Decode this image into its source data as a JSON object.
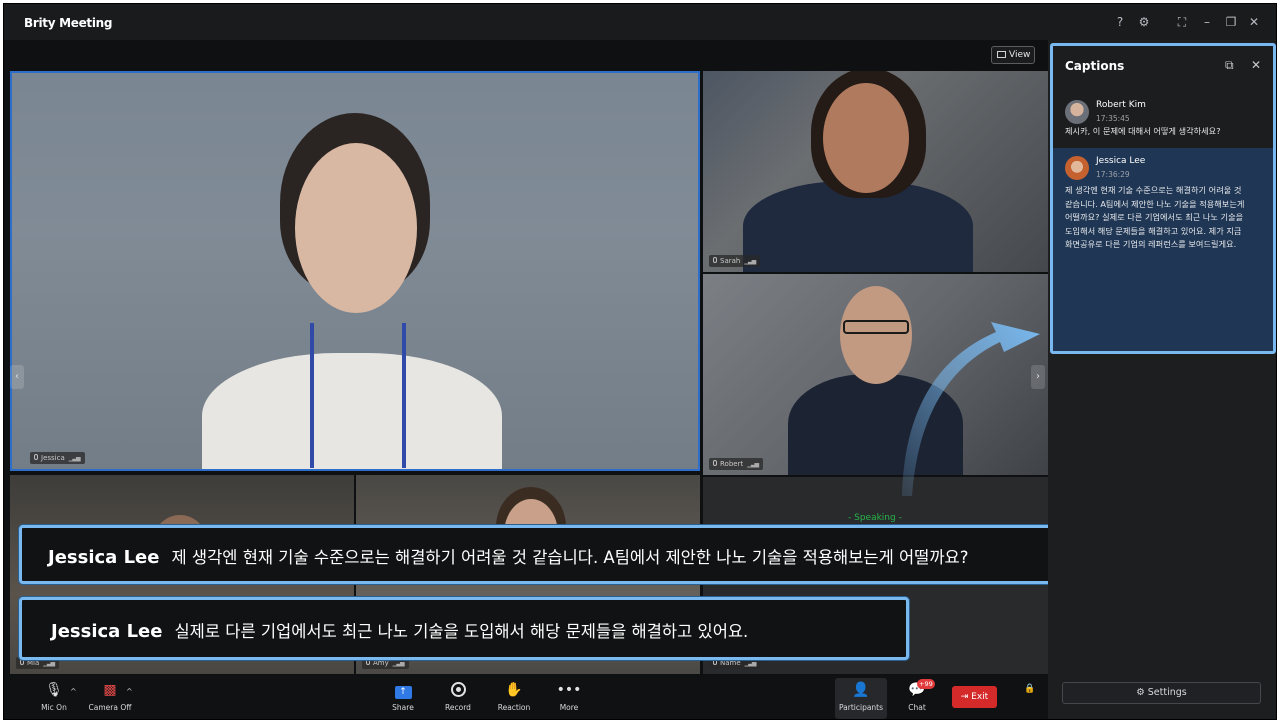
{
  "app": {
    "title": "Brity Meeting"
  },
  "window_controls": {
    "help": "?",
    "settings": "⚙",
    "fullscreen": "⛶",
    "minimize": "–",
    "restore": "❐",
    "close": "✕"
  },
  "video": {
    "view_label": "View",
    "speaking_label": "- Speaking -",
    "tiles": [
      {
        "name": "Jessica"
      },
      {
        "name": "Sarah"
      },
      {
        "name": "Robert"
      },
      {
        "name": "Mia"
      },
      {
        "name": "Amy"
      },
      {
        "name": "Name"
      }
    ]
  },
  "live_captions": [
    {
      "speaker": "Jessica Lee",
      "text": "제 생각엔 현재 기술 수준으로는 해결하기 어려울 것 같습니다. A팀에서 제안한 나노 기술을 적용해보는게 어떨까요?"
    },
    {
      "speaker": "Jessica Lee",
      "text": "실제로 다른 기업에서도 최근  나노 기술을 도입해서 해당 문제들을 해결하고 있어요."
    }
  ],
  "captions_panel": {
    "title": "Captions",
    "messages": [
      {
        "name": "Robert Kim",
        "time": "17:35:45",
        "text": "제시카, 이 문제에 대해서 어떻게 생각하세요?"
      },
      {
        "name": "Jessica Lee",
        "time": "17:36:29",
        "text": "제 생각엔 현재 기술 수준으로는 해결하기 어려울 것 같습니다. A팀에서 제안한 나노 기술을 적용해보는게 어떨까요? 실제로 다른 기업에서도 최근 나노 기술을 도입해서 해당 문제들을 해결하고 있어요. 제가 지금 화면공유로 다른 기업의 레퍼런스를 보여드릴게요."
      }
    ],
    "settings_label": "Settings"
  },
  "toolbar": {
    "mic_label": "Mic On",
    "camera_label": "Camera Off",
    "share_label": "Share",
    "record_label": "Record",
    "reaction_label": "Reaction",
    "more_label": "More",
    "participants_label": "Participants",
    "chat_label": "Chat",
    "chat_badge": "+99",
    "exit_label": "Exit"
  },
  "colors": {
    "accent": "#79b9f0",
    "exit": "#d42a2a",
    "speaking": "#27b34a",
    "share": "#2f7ae5"
  }
}
